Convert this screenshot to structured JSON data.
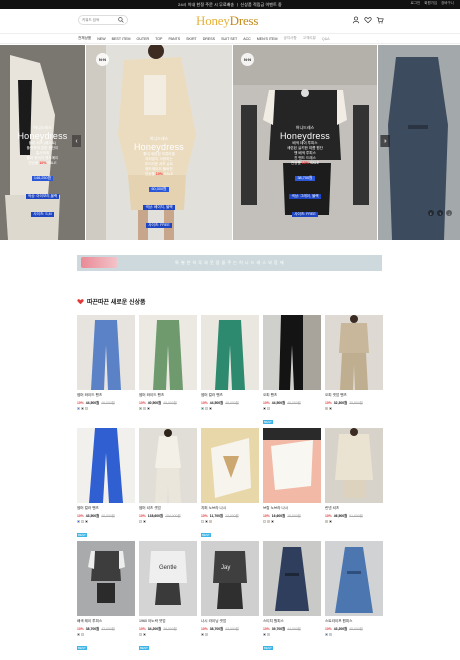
{
  "topbar": {
    "promo": "24시 이내 한정 주문 시 무료배송 ㅣ 신상품 적립금 이벤트 중",
    "util": [
      "로그인",
      "회원가입",
      "장바구니"
    ]
  },
  "header": {
    "search_placeholder": "키워드 검색",
    "logo_a": "Honey",
    "logo_b": "Dress"
  },
  "nav": {
    "items": [
      "전체상품",
      "NEW",
      "BEST ITEM",
      "OUTER",
      "TOP",
      "PANTS",
      "SKIRT",
      "DRESS",
      "SUIT SET",
      "ACC",
      "MEN'S ITEM"
    ],
    "muted": [
      "공지사항",
      "고객리뷰",
      "Q&A"
    ]
  },
  "hero": {
    "slides": [
      {
        "brand_sm": "허니드레스",
        "brand": "Honeydress",
        "lines": [
          "폴리 셔츠 (베스트)",
          "플랫하게 흔한 원단이",
          "흡사하게",
          "플러 한데이 핸드메이",
          "전상품"
        ],
        "sale_pct": "10%",
        "sale_txt": "SALE",
        "price": "146,250원",
        "tag1": "색상: 아이보리,블랙",
        "tag2": "사이즈: S,M"
      },
      {
        "brand_sm": "허니드레스",
        "brand": "Honeydress",
        "lines": [
          "좋네 세련된 의류라벨",
          "여러분이 사랑하는",
          "부드러운 셔츠 슈트",
          "핸드메이드 풀버전",
          "전상품"
        ],
        "sale_pct": "10%",
        "sale_txt": "SALE",
        "price": "60,000원",
        "tag1": "색상: 베이지, 블랙",
        "tag2": "사이즈: FREE"
      },
      {
        "brand_sm": "허니드레스",
        "brand": "Honeydress",
        "lines": [
          "배색 데이 투피스",
          "세련된 실키한 여름 원단",
          "맨 배색 투피스",
          "진 밴드 드레스",
          "전상품"
        ],
        "sale_pct": "10%",
        "sale_txt": "SALE",
        "price": "38,700원",
        "tag1": "색상: 그레이, 블랙",
        "tag2": "사이즈: FREE"
      }
    ]
  },
  "strip": {
    "text": "특 별 한   하 루 와   웃 음 을   주 는   허 니 드 레 스 와   함 께"
  },
  "section": {
    "title": "따끈따끈 새로운 신상품"
  },
  "products": [
    {
      "name": "썸머 와이드 팬츠",
      "pct": "10%",
      "now": "44,500원",
      "old": "49,000원",
      "colors": [
        "#5b82c7",
        "#444",
        "#e5d9c4"
      ]
    },
    {
      "name": "썸머 와이드 팬츠",
      "pct": "10%",
      "now": "40,500원",
      "old": "45,000원",
      "colors": [
        "#6e9a6e",
        "#ccc",
        "#222"
      ]
    },
    {
      "name": "썸머 컬러 팬츠",
      "pct": "10%",
      "now": "44,500원",
      "old": "49,000원",
      "colors": [
        "#2d8a6e",
        "#ddd",
        "#222"
      ]
    },
    {
      "name": "오피 팬츠",
      "pct": "10%",
      "now": "44,500원",
      "old": "49,000원",
      "colors": [
        "#111",
        "#ddd"
      ],
      "best": "BEST"
    },
    {
      "name": "오피 셋업 팬츠",
      "pct": "10%",
      "now": "32,300원",
      "old": "35,900원",
      "colors": [
        "#c8b79a",
        "#333"
      ]
    },
    {
      "name": "썸머 컬러 팬츠",
      "pct": "10%",
      "now": "43,500원",
      "old": "48,000원",
      "colors": [
        "#2f5fd0",
        "#ddd",
        "#222"
      ],
      "best": "BEST"
    },
    {
      "name": "썸머 셔츠 셋업",
      "pct": "10%",
      "now": "138,600원",
      "old": "154,000원",
      "colors": [
        "#e9e4da",
        "#222"
      ]
    },
    {
      "name": "지퍼 노브라 나시",
      "pct": "10%",
      "now": "11,700원",
      "old": "13,000원",
      "colors": [
        "#f1efe6",
        "#222",
        "#e5c29a"
      ],
      "best": "BEST"
    },
    {
      "name": "브랍 노브라 나시",
      "pct": "10%",
      "now": "16,600원",
      "old": "18,500원",
      "colors": [
        "#eee",
        "#f2b9a6",
        "#222"
      ]
    },
    {
      "name": "린넨 셔츠",
      "pct": "10%",
      "now": "46,500원",
      "old": "51,600원",
      "colors": [
        "#c9b99a",
        "#222"
      ]
    },
    {
      "name": "배색 레이 투피스",
      "pct": "10%",
      "now": "38,700원",
      "old": "43,000원",
      "colors": [
        "#555",
        "#ddd"
      ],
      "best": "BEST"
    },
    {
      "name": "1960 아노락 셋업",
      "pct": "10%",
      "now": "34,200원",
      "old": "38,000원",
      "colors": [
        "#ddd",
        "#333"
      ],
      "best": "BEST"
    },
    {
      "name": "나시 라이닝 셋업",
      "pct": "10%",
      "now": "38,700원",
      "old": "43,000원",
      "colors": [
        "#444",
        "#ccc"
      ]
    },
    {
      "name": "스티치 원피스",
      "pct": "10%",
      "now": "39,700원",
      "old": "44,000원",
      "colors": [
        "#2e3e5c",
        "#ccc"
      ],
      "best": "BEST"
    },
    {
      "name": "스트라이프 원피스",
      "pct": "10%",
      "now": "43,200원",
      "old": "48,000원",
      "colors": [
        "#4b76b0",
        "#ccc"
      ]
    }
  ],
  "colors": {
    "accent_red": "#e23a3a",
    "logo_gold": "#e6b23a",
    "badge_blue": "#3fb4e6",
    "price_blue": "#2c58d8"
  }
}
